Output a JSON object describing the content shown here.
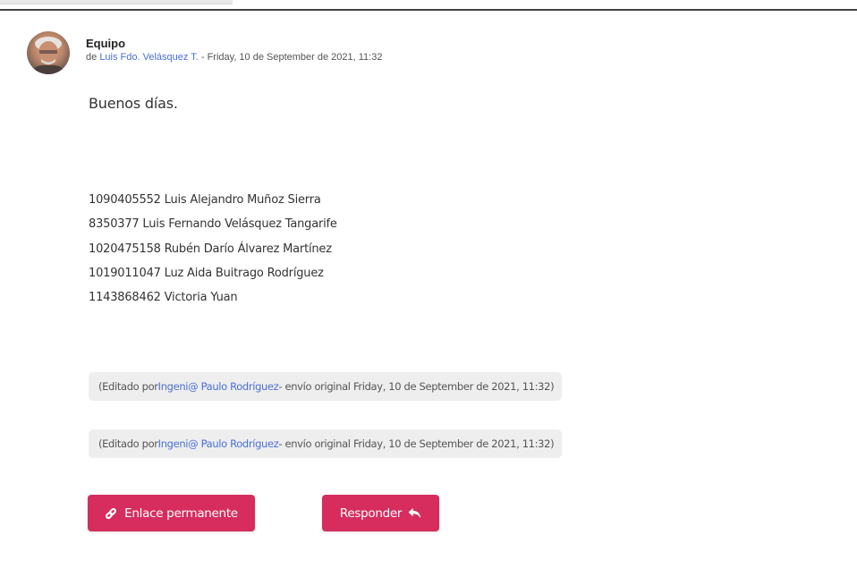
{
  "message": {
    "subject": "Equipo",
    "from_prefix": "de",
    "author": "Luis Fdo. Velásquez T.",
    "date_text": "- Friday, 10 de September de 2021, 11:32",
    "greeting": "Buenos días.",
    "lines": [
      "1090405552 Luis Alejandro Muñoz Sierra",
      "8350377 Luis Fernando Velásquez Tangarife",
      "1020475158 Rubén Darío Álvarez Martínez",
      "1019011047 Luz Aida Buitrago Rodríguez",
      "1143868462 Victoria Yuan"
    ]
  },
  "edits": [
    {
      "prefix": "(Editado por",
      "editor": "Ingeni@ Paulo Rodríguez",
      "suffix": "- envío original Friday, 10 de September de 2021, 11:32)"
    },
    {
      "prefix": "(Editado por",
      "editor": "Ingeni@ Paulo Rodríguez",
      "suffix": "- envío original Friday, 10 de September de 2021, 11:32)"
    }
  ],
  "actions": {
    "permalink_label": "Enlace permanente",
    "permalink_icon": "link-icon",
    "reply_label": "Responder",
    "reply_icon": "reply-icon"
  },
  "colors": {
    "accent_button": "#d62d5e",
    "link": "#4a6fd8",
    "note_background": "#eeeeee"
  }
}
